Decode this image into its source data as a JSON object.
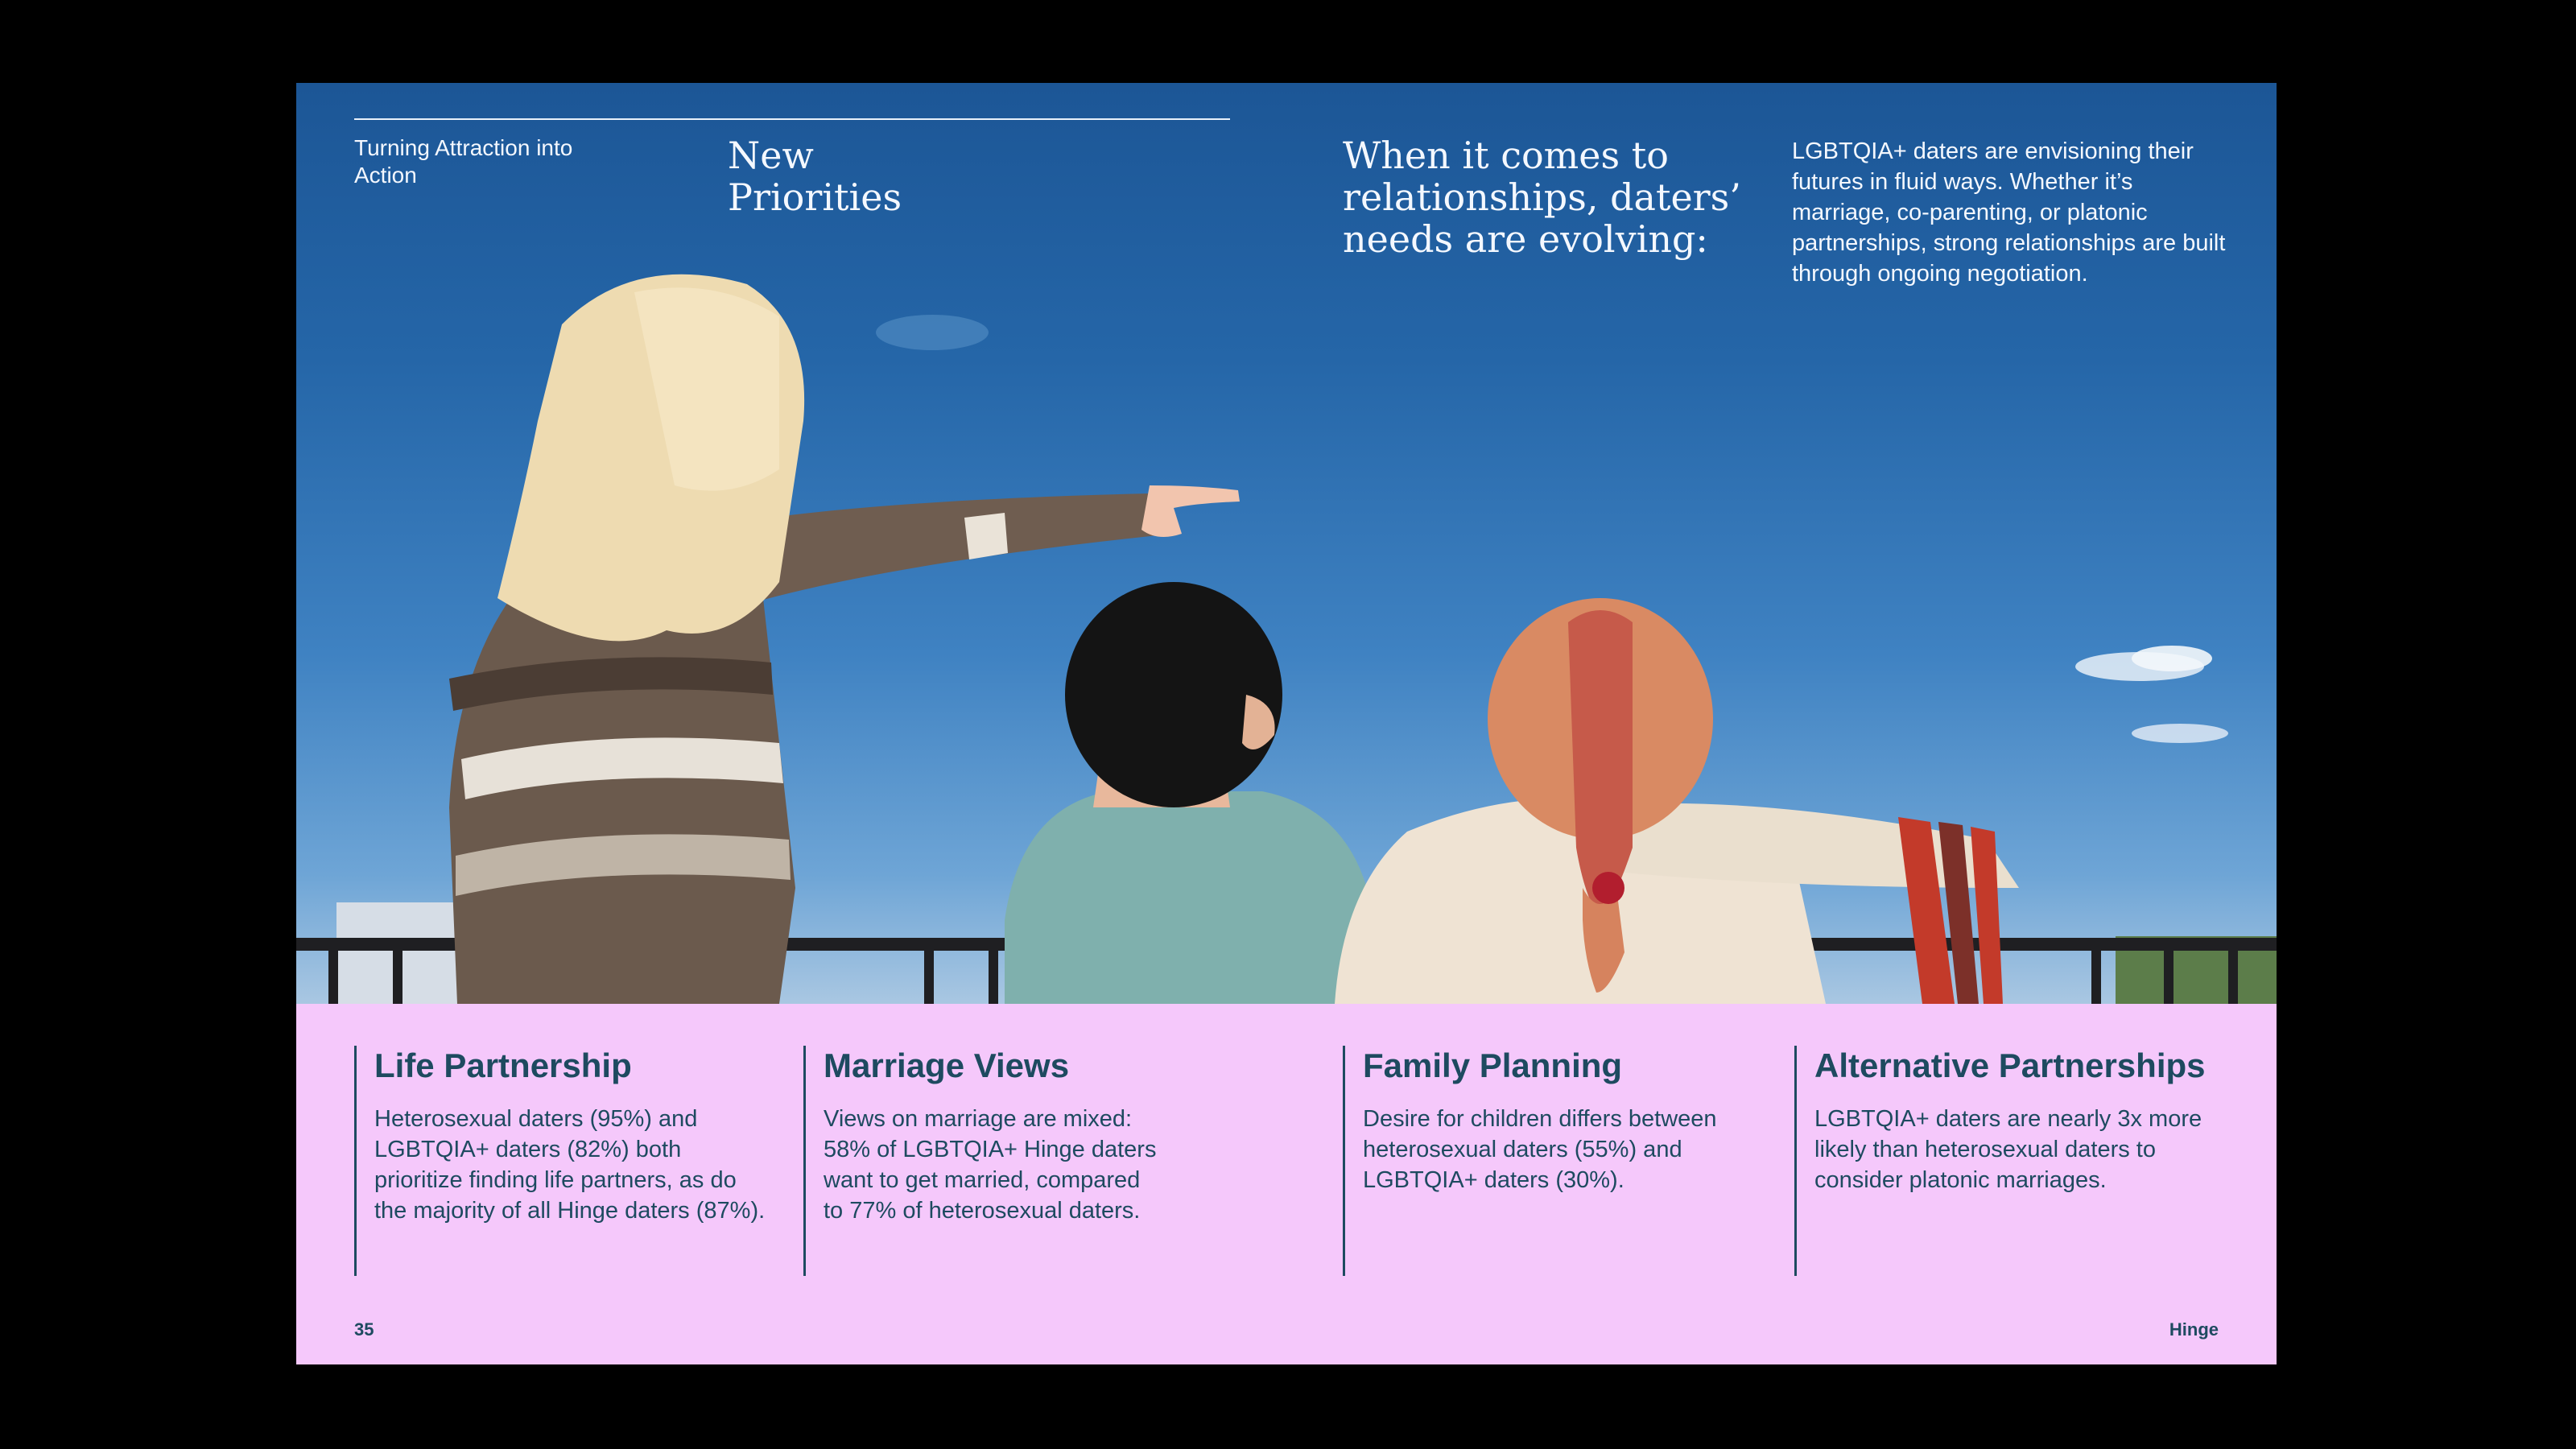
{
  "header": {
    "kicker": "Turning Attraction into Action",
    "section_title": "New Priorities",
    "headline": "When it comes to relationships, daters’ needs are evolving:",
    "intro": "LGBTQIA+ daters are envisioning their futures in fluid ways. Whether it’s marriage, co-parenting, or platonic partnerships, strong relationships are built through ongoing negotiation."
  },
  "cards": [
    {
      "title": "Life Partnership",
      "body": "Heterosexual daters (95%) and LGBTQIA+ daters (82%) both prioritize finding life partners, as do the majority of all Hinge daters (87%)."
    },
    {
      "title": "Marriage Views",
      "body": "Views on marriage are mixed: 58% of LGBTQIA+ Hinge daters want to get married, compared to 77% of heterosexual daters."
    },
    {
      "title": "Family Planning",
      "body": "Desire for children differs between heterosexual daters (55%) and LGBTQIA+ daters (30%)."
    },
    {
      "title": "Alternative Partnerships",
      "body": "LGBTQIA+ daters are nearly 3x more likely than heterosexual daters to consider platonic marriages."
    }
  ],
  "footer": {
    "page_number": "35",
    "brand": "Hinge"
  },
  "colors": {
    "panel_background": "#f5c8fb",
    "ink": "#1e4a60",
    "sky": "#2566a8"
  }
}
